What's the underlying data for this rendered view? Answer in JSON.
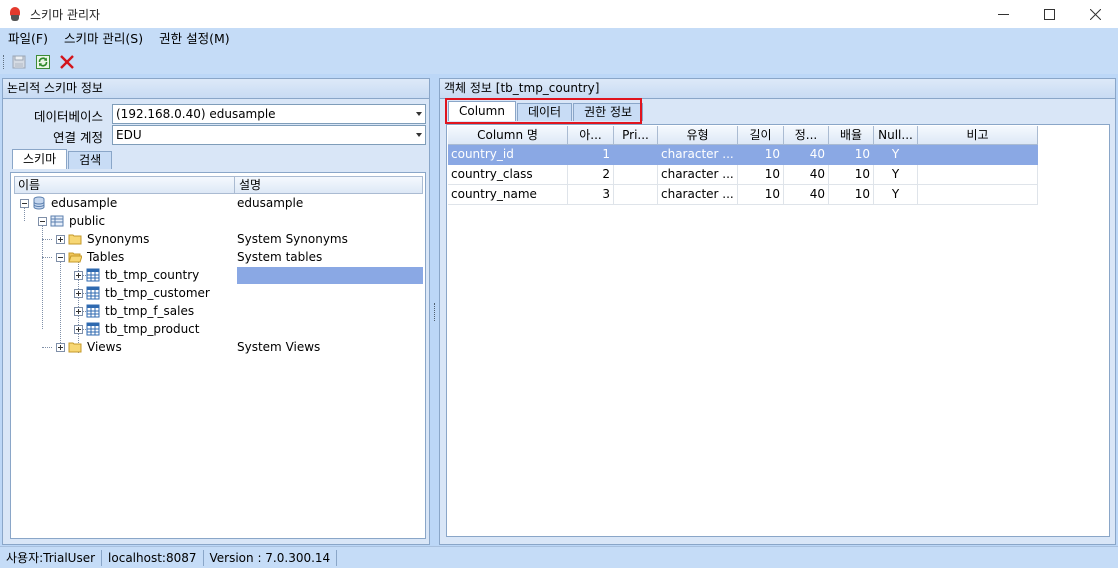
{
  "window": {
    "title": "스키마 관리자",
    "controls": [
      "minimize-icon",
      "maximize-icon",
      "close-icon"
    ]
  },
  "menu": {
    "items": [
      "파일(F)",
      "스키마 관리(S)",
      "권한 설정(M)"
    ]
  },
  "toolbar": {
    "buttons": [
      {
        "icon": "save-icon",
        "enabled": false
      },
      {
        "icon": "refresh-icon",
        "enabled": true
      },
      {
        "icon": "delete-icon",
        "enabled": true
      }
    ]
  },
  "left_panel": {
    "header": "논리적 스키마 정보",
    "database_label": "데이터베이스",
    "database_value": "(192.168.0.40) edusample",
    "account_label": "연결 계정",
    "account_value": "EDU",
    "tabs": [
      "스키마",
      "검색"
    ],
    "tree_columns": [
      "이름",
      "설명"
    ],
    "tree": [
      {
        "label": "edusample",
        "desc": "edusample",
        "icon": "database-icon"
      },
      {
        "label": "public",
        "desc": "",
        "icon": "schema-icon"
      },
      {
        "label": "Synonyms",
        "desc": "System Synonyms",
        "icon": "folder-icon"
      },
      {
        "label": "Tables",
        "desc": "System tables",
        "icon": "folder-open-icon"
      },
      {
        "label": "tb_tmp_country",
        "desc": "",
        "icon": "table-icon",
        "selected": true
      },
      {
        "label": "tb_tmp_customer",
        "desc": "",
        "icon": "table-icon"
      },
      {
        "label": "tb_tmp_f_sales",
        "desc": "",
        "icon": "table-icon"
      },
      {
        "label": "tb_tmp_product",
        "desc": "",
        "icon": "table-icon"
      },
      {
        "label": "Views",
        "desc": "System Views",
        "icon": "folder-icon"
      }
    ]
  },
  "right_panel": {
    "header": "객체 정보  [tb_tmp_country]",
    "tabs": [
      "Column",
      "데이터",
      "권한 정보"
    ],
    "active_tab": "Column",
    "grid_columns": [
      "Column 명",
      "아...",
      "Pri...",
      "유형",
      "길이",
      "정...",
      "배율",
      "Null...",
      "비고"
    ],
    "rows": [
      {
        "name": "country_id",
        "order": "1",
        "pk": "",
        "type": "character ...",
        "length": "10",
        "precision": "40",
        "scale": "10",
        "nullable": "Y",
        "remark": "",
        "selected": true
      },
      {
        "name": "country_class",
        "order": "2",
        "pk": "",
        "type": "character ...",
        "length": "10",
        "precision": "40",
        "scale": "10",
        "nullable": "Y",
        "remark": ""
      },
      {
        "name": "country_name",
        "order": "3",
        "pk": "",
        "type": "character ...",
        "length": "10",
        "precision": "40",
        "scale": "10",
        "nullable": "Y",
        "remark": ""
      }
    ]
  },
  "status": {
    "user": "사용자:TrialUser",
    "host": "localhost:8087",
    "version": "Version : 7.0.300.14"
  },
  "colors": {
    "selection": "#8aa8e4",
    "highlight_box": "#e0141e",
    "chrome": "#c5dcf7"
  }
}
